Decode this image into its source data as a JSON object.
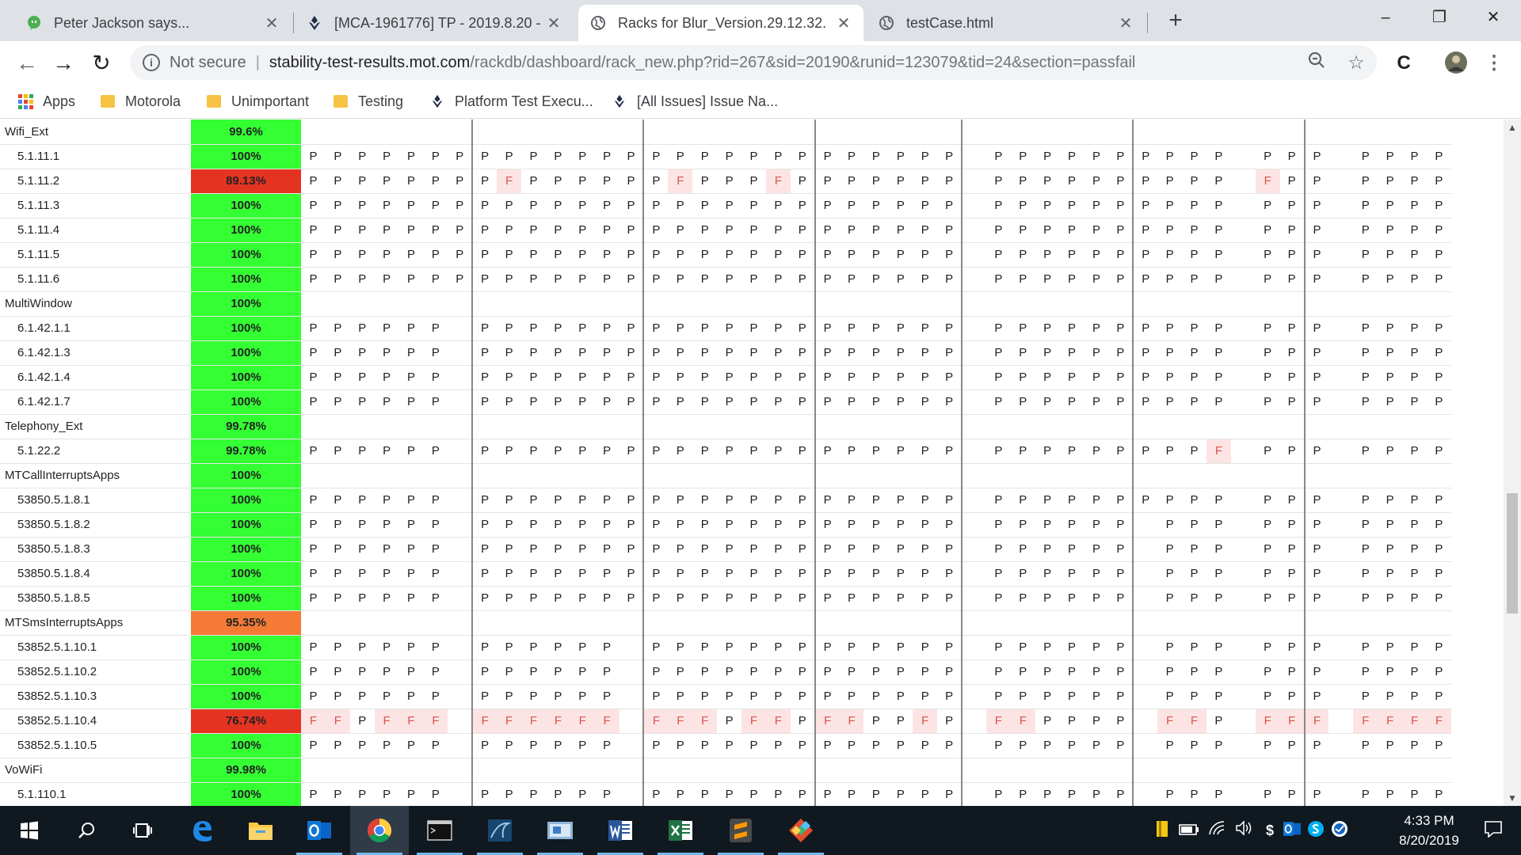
{
  "browser": {
    "tabs": [
      {
        "title": "Peter Jackson says...",
        "icon": "chat-bubble-icon",
        "active": false
      },
      {
        "title": "[MCA-1961776] TP - 2019.8.20 - ",
        "icon": "jira-icon",
        "active": false
      },
      {
        "title": "Racks for Blur_Version.29.12.32.",
        "icon": "globe-icon",
        "active": true
      },
      {
        "title": "testCase.html",
        "icon": "globe-icon",
        "active": false
      }
    ],
    "new_tab": "+",
    "window_controls": {
      "minimize": "–",
      "restore": "❐",
      "close": "✕"
    },
    "security_label": "Not secure",
    "url_host": "stability-test-results.mot.com",
    "url_path": "/rackdb/dashboard/rack_new.php?rid=267&sid=20190&runid=123079&tid=24&section=passfail",
    "bookmarks": [
      {
        "label": "Apps",
        "icon": "apps-grid-icon"
      },
      {
        "label": "Motorola",
        "icon": "folder-icon"
      },
      {
        "label": "Unimportant",
        "icon": "folder-icon"
      },
      {
        "label": "Testing",
        "icon": "folder-icon"
      },
      {
        "label": "Platform Test Execu...",
        "icon": "jira-icon"
      },
      {
        "label": "[All Issues] Issue Na...",
        "icon": "jira-icon"
      }
    ]
  },
  "grid": {
    "group_sizes": [
      7,
      7,
      7,
      6,
      7,
      7,
      6
    ],
    "colors": {
      "pass_bg": "#33ff33",
      "fail_bg": "#e53322",
      "warn_bg": "#f47a35",
      "cell_fail_bg": "#fde4e4",
      "cell_fail_text": "#d9534f"
    },
    "rows": [
      {
        "type": "cat",
        "name": "Wifi_Ext",
        "pct": "99.6%",
        "color": "green"
      },
      {
        "type": "test",
        "name": "5.1.11.1",
        "pct": "100%",
        "color": "green",
        "cells": "PPPPPPP|PPPPPPP|PPPPPPP|PPPPPP_|PPPPPPP|PPP_PPP|_PPPPPP"
      },
      {
        "type": "test",
        "name": "5.1.11.2",
        "pct": "89.13%",
        "color": "red",
        "cells": "PPPPPPP|PFPPPPP|PFPPPFP|PPPPPP_|PPPPPPP|PPP_FPP|_PPPPFP"
      },
      {
        "type": "test",
        "name": "5.1.11.3",
        "pct": "100%",
        "color": "green",
        "cells": "PPPPPPP|PPPPPPP|PPPPPPP|PPPPPP_|PPPPPPP|PPP_PPP|_PPPPPP"
      },
      {
        "type": "test",
        "name": "5.1.11.4",
        "pct": "100%",
        "color": "green",
        "cells": "PPPPPPP|PPPPPPP|PPPPPPP|PPPPPP_|PPPPPPP|PPP_PPP|_PPPPPP"
      },
      {
        "type": "test",
        "name": "5.1.11.5",
        "pct": "100%",
        "color": "green",
        "cells": "PPPPPPP|PPPPPPP|PPPPPPP|PPPPPP_|PPPPPPP|PPP_PPP|_PPPPPP"
      },
      {
        "type": "test",
        "name": "5.1.11.6",
        "pct": "100%",
        "color": "green",
        "cells": "PPPPPPP|PPPPPPP|PPPPPPP|PPPPPP_|PPPPPPP|PPP_PPP|_PPPPPP"
      },
      {
        "type": "cat",
        "name": "MultiWindow",
        "pct": "100%",
        "color": "green"
      },
      {
        "type": "test",
        "name": "6.1.42.1.1",
        "pct": "100%",
        "color": "green",
        "cells": "PPPPPP_|PPPPPPP|PPPPPPP|PPPPPP_|PPPPPPP|PPP_PPP|_PPPPPP"
      },
      {
        "type": "test",
        "name": "6.1.42.1.3",
        "pct": "100%",
        "color": "green",
        "cells": "PPPPPP_|PPPPPPP|PPPPPPP|PPPPPP_|PPPPPPP|PPP_PPP|_PPPPPP"
      },
      {
        "type": "test",
        "name": "6.1.42.1.4",
        "pct": "100%",
        "color": "green",
        "cells": "PPPPPP_|PPPPPPP|PPPPPPP|PPPPPP_|PPPPPPP|PPP_PPP|_PPPPPP"
      },
      {
        "type": "test",
        "name": "6.1.42.1.7",
        "pct": "100%",
        "color": "green",
        "cells": "PPPPPP_|PPPPPPP|PPPPPPP|PPPPPP_|PPPPPPP|PPP_PPP|_PPPPPP"
      },
      {
        "type": "cat",
        "name": "Telephony_Ext",
        "pct": "99.78%",
        "color": "green"
      },
      {
        "type": "test",
        "name": "5.1.22.2",
        "pct": "99.78%",
        "color": "green",
        "cells": "PPPPPP_|PPPPPPP|PPPPPPP|PPPPPP_|PPPPPPP|PPF_PPP|_PPPPPP"
      },
      {
        "type": "cat",
        "name": "MTCallInterruptsApps",
        "pct": "100%",
        "color": "green"
      },
      {
        "type": "test",
        "name": "53850.5.1.8.1",
        "pct": "100%",
        "color": "green",
        "cells": "PPPPPP_|PPPPPPP|PPPPPPP|PPPPPP_|PPPPPPP|PPP_PPP|_PPPPPP"
      },
      {
        "type": "test",
        "name": "53850.5.1.8.2",
        "pct": "100%",
        "color": "green",
        "cells": "PPPPPP_|PPPPPPP|PPPPPPP|PPPPPP_|PPPPPP_|PPP_PPP|_PPPPPP"
      },
      {
        "type": "test",
        "name": "53850.5.1.8.3",
        "pct": "100%",
        "color": "green",
        "cells": "PPPPPP_|PPPPPPP|PPPPPPP|PPPPPP_|PPPPPP_|PPP_PPP|_PPPPPP"
      },
      {
        "type": "test",
        "name": "53850.5.1.8.4",
        "pct": "100%",
        "color": "green",
        "cells": "PPPPPP_|PPPPPPP|PPPPPPP|PPPPPP_|PPPPPP_|PPP_PPP|_PPPPPP"
      },
      {
        "type": "test",
        "name": "53850.5.1.8.5",
        "pct": "100%",
        "color": "green",
        "cells": "PPPPPP_|PPPPPPP|PPPPPPP|PPPPPP_|PPPPPP_|PPP_PPP|_PPPPPP"
      },
      {
        "type": "cat",
        "name": "MTSmsInterruptsApps",
        "pct": "95.35%",
        "color": "orange"
      },
      {
        "type": "test",
        "name": "53852.5.1.10.1",
        "pct": "100%",
        "color": "green",
        "cells": "PPPPPP_|PPPPPP_|PPPPPPP|PPPPPP_|PPPPPP_|PPP_PPP|_PPPPPP"
      },
      {
        "type": "test",
        "name": "53852.5.1.10.2",
        "pct": "100%",
        "color": "green",
        "cells": "PPPPPP_|PPPPPP_|PPPPPPP|PPPPPP_|PPPPPP_|PPP_PPP|_PPPPPP"
      },
      {
        "type": "test",
        "name": "53852.5.1.10.3",
        "pct": "100%",
        "color": "green",
        "cells": "PPPPPP_|PPPPPP_|PPPPPPP|PPPPPP_|PPPPPP_|PPP_PPP|_PPPPPP"
      },
      {
        "type": "test",
        "name": "53852.5.1.10.4",
        "pct": "76.74%",
        "color": "red",
        "cells": "FFPFFF_|FFFFFF_|FFFPFFP|FFPPFP_|FFPPPP_|FFP_FFF|_FFFFFP"
      },
      {
        "type": "test",
        "name": "53852.5.1.10.5",
        "pct": "100%",
        "color": "green",
        "cells": "PPPPPP_|PPPPPP_|PPPPPPP|PPPPPP_|PPPPPP_|PPP_PPP|_PPPPPP"
      },
      {
        "type": "cat",
        "name": "VoWiFi",
        "pct": "99.98%",
        "color": "green"
      },
      {
        "type": "test",
        "name": "5.1.110.1",
        "pct": "100%",
        "color": "green",
        "cells": "PPPPPP_|PPPPPP_|PPPPPPP|PPPPPP_|PPPPPP_|PPP_PPP|_PPPPPP"
      }
    ]
  },
  "taskbar": {
    "apps": [
      {
        "icon": "windows-start-icon",
        "label": ""
      },
      {
        "icon": "search-icon",
        "label": ""
      },
      {
        "icon": "task-view-icon",
        "label": ""
      },
      {
        "icon": "edge-icon",
        "label": ""
      },
      {
        "icon": "file-explorer-icon",
        "label": ""
      },
      {
        "icon": "outlook-icon",
        "label": ""
      },
      {
        "icon": "chrome-icon",
        "label": ""
      },
      {
        "icon": "terminal-icon",
        "label": ""
      },
      {
        "icon": "wireshark-icon",
        "label": ""
      },
      {
        "icon": "remote-desktop-icon",
        "label": ""
      },
      {
        "icon": "word-icon",
        "label": ""
      },
      {
        "icon": "excel-icon",
        "label": ""
      },
      {
        "icon": "sublime-icon",
        "label": ""
      },
      {
        "icon": "git-icon",
        "label": ""
      }
    ],
    "time": "4:33 PM",
    "date": "8/20/2019"
  }
}
